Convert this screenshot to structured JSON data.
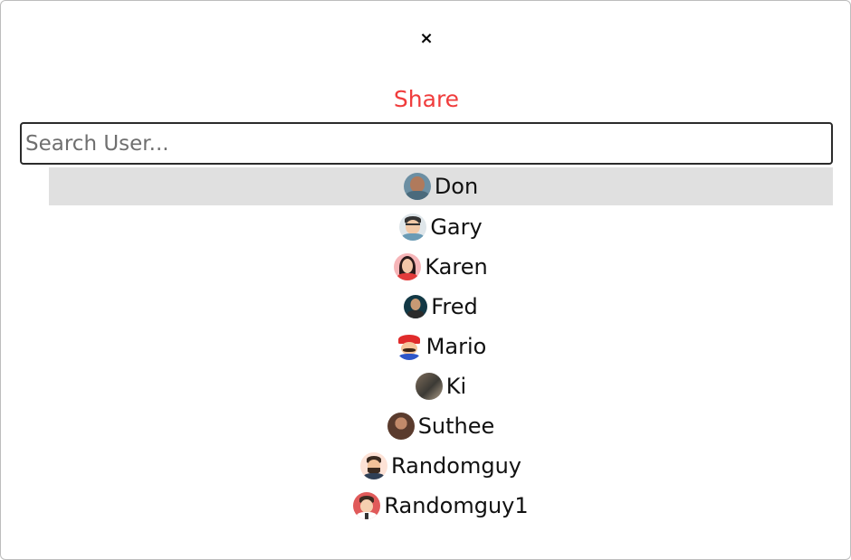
{
  "modal": {
    "close_label": "×",
    "title": "Share"
  },
  "search": {
    "placeholder": "Search User...",
    "value": ""
  },
  "users": [
    {
      "name": "Don",
      "icon": "don-avatar",
      "selected": true
    },
    {
      "name": "Gary",
      "icon": "gary-avatar",
      "selected": false
    },
    {
      "name": "Karen",
      "icon": "karen-avatar",
      "selected": false
    },
    {
      "name": "Fred",
      "icon": "fred-avatar",
      "selected": false
    },
    {
      "name": "Mario",
      "icon": "mario-avatar",
      "selected": false
    },
    {
      "name": "Ki",
      "icon": "ki-avatar",
      "selected": false
    },
    {
      "name": "Suthee",
      "icon": "suthee-avatar",
      "selected": false
    },
    {
      "name": "Randomguy",
      "icon": "randomguy-avatar",
      "selected": false
    },
    {
      "name": "Randomguy1",
      "icon": "randomguy1-avatar",
      "selected": false
    }
  ],
  "colors": {
    "title": "#f03c3c",
    "selected_row": "#e0e0e0",
    "border": "#2b2b2b"
  }
}
